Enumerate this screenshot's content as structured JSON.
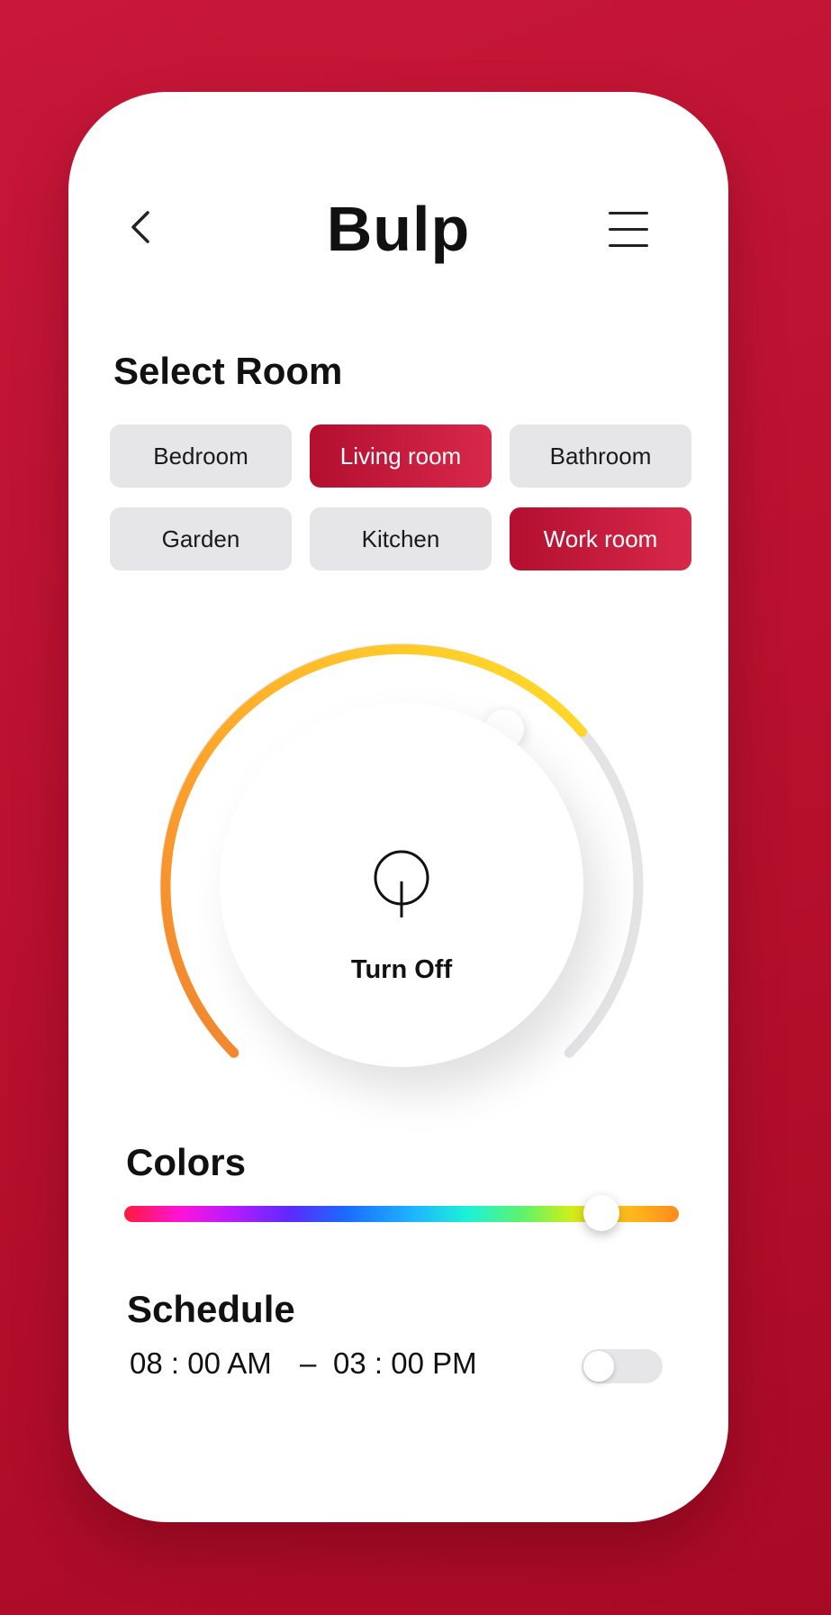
{
  "header": {
    "title": "Bulp",
    "back_icon": "chevron-left-icon",
    "menu_icon": "hamburger-menu-icon"
  },
  "rooms": {
    "title": "Select Room",
    "items": [
      {
        "label": "Bedroom",
        "selected": false
      },
      {
        "label": "Living room",
        "selected": true
      },
      {
        "label": "Bathroom",
        "selected": false
      },
      {
        "label": "Garden",
        "selected": false
      },
      {
        "label": "Kitchen",
        "selected": false
      },
      {
        "label": "Work room",
        "selected": true
      }
    ]
  },
  "dial": {
    "power_icon": "power-icon",
    "label": "Turn Off",
    "level": 0.75,
    "colors": {
      "start": "#f0812f",
      "end": "#ffe02a",
      "track": "#e4e4e6"
    }
  },
  "colors": {
    "title": "Colors",
    "slider_value": 0.86
  },
  "schedule": {
    "title": "Schedule",
    "start_time": "08 : 00 AM",
    "separator": "–",
    "end_time": "03 : 00 PM",
    "enabled": false
  },
  "theme": {
    "accent": "#c8173a",
    "active_gradient_start": "#b30f2f",
    "active_gradient_end": "#d8284a"
  }
}
